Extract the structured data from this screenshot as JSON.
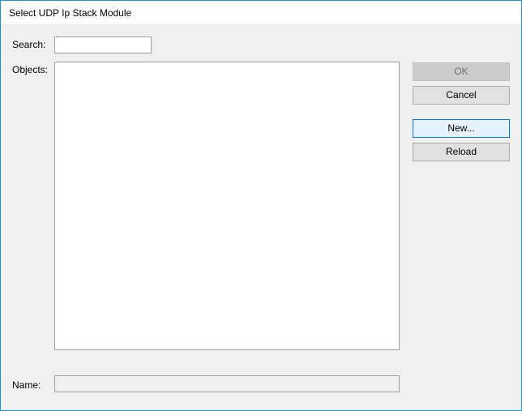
{
  "window": {
    "title": "Select UDP Ip Stack Module"
  },
  "labels": {
    "search": "Search:",
    "objects": "Objects:",
    "name": "Name:"
  },
  "fields": {
    "search_value": "",
    "name_value": ""
  },
  "objects_list": [],
  "buttons": {
    "ok": "OK",
    "cancel": "Cancel",
    "new": "New...",
    "reload": "Reload"
  },
  "state": {
    "ok_enabled": false,
    "new_highlighted": true
  }
}
